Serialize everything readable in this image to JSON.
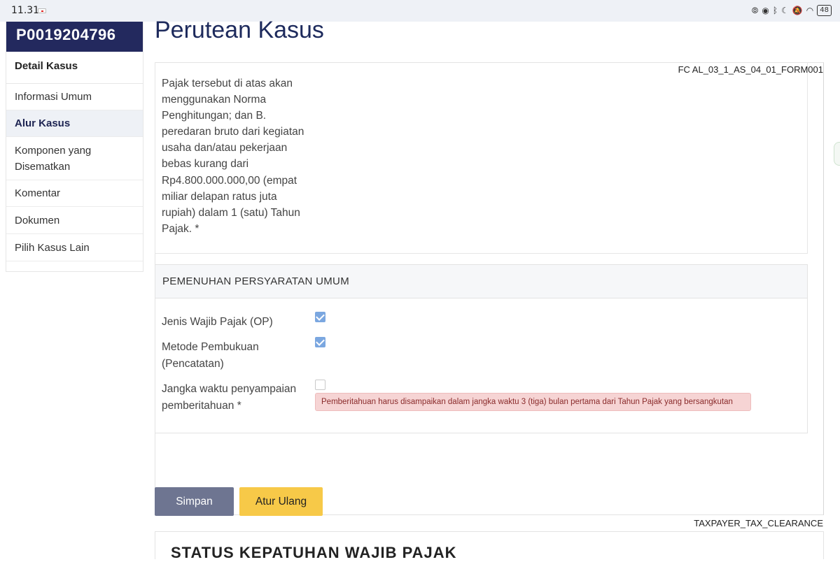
{
  "status_bar": {
    "time": "11.31",
    "icons": [
      "nfc-icon",
      "eye-icon",
      "bluetooth-icon",
      "moon-icon",
      "mute-icon",
      "wifi-icon"
    ],
    "battery": "48"
  },
  "sidebar": {
    "case_id": "P0019204796",
    "title": "Detail Kasus",
    "items": [
      {
        "label": "Informasi Umum",
        "active": false
      },
      {
        "label": "Alur Kasus",
        "active": true
      },
      {
        "label": "Komponen yang Disematkan",
        "active": false
      },
      {
        "label": "Komentar",
        "active": false
      },
      {
        "label": "Dokumen",
        "active": false
      },
      {
        "label": "Pilih Kasus Lain",
        "active": false
      }
    ]
  },
  "main": {
    "page_title": "Perutean Kasus",
    "form_code": "FC AL_03_1_AS_04_01_FORM001",
    "norma_text": "Pajak tersebut di atas akan menggunakan Norma Penghitungan; dan B. peredaran bruto dari kegiatan usaha dan/atau pekerjaan bebas kurang dari Rp4.800.000.000,00 (empat miliar delapan ratus juta rupiah) dalam 1 (satu) Tahun Pajak. *",
    "section": {
      "title": "PEMENUHAN PERSYARATAN UMUM",
      "rows": [
        {
          "label": "Jenis Wajib Pajak (OP)",
          "checked": true
        },
        {
          "label": "Metode Pembukuan (Pencatatan)",
          "checked": true
        },
        {
          "label": "Jangka waktu penyampaian pemberitahuan *",
          "checked": false
        }
      ],
      "alert": "Pemberitahuan harus disampaikan dalam jangka waktu 3 (tiga) bulan pertama dari Tahun Pajak yang bersangkutan"
    },
    "buttons": {
      "save": "Simpan",
      "reset": "Atur Ulang"
    },
    "footer_code": "TAXPAYER_TAX_CLEARANCE",
    "next_section_title": "STATUS KEPATUHAN WAJIB PAJAK"
  },
  "colors": {
    "sidebar_header": "#23295e",
    "title": "#1d2a5c",
    "save_button": "#6e7591",
    "reset_button": "#f7c948",
    "checkbox_on": "#7ba7e0",
    "alert_bg": "#f6d4d4"
  }
}
